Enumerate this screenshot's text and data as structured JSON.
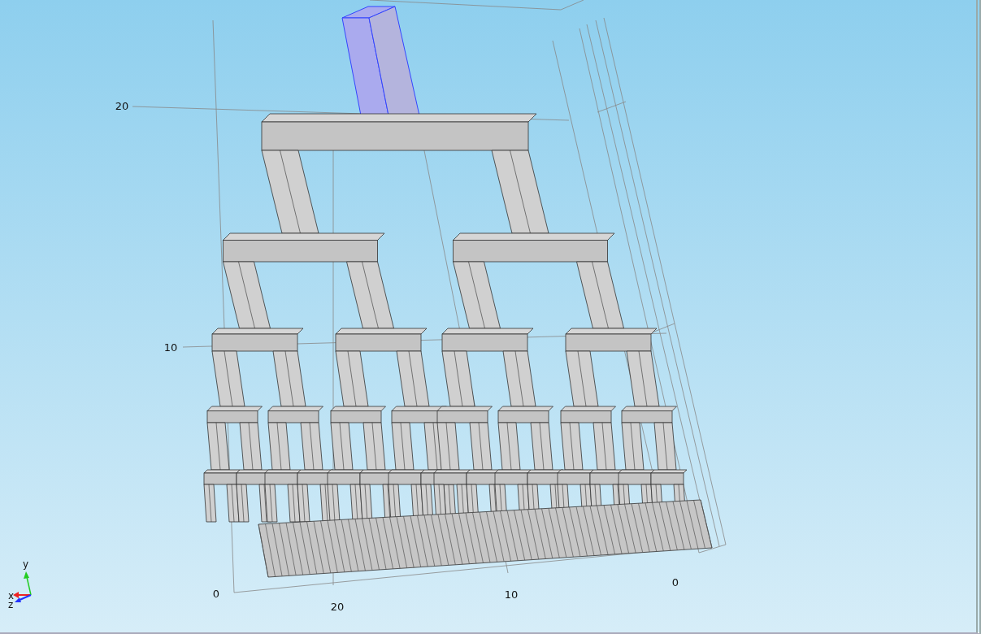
{
  "viewport": {
    "vertical_axis_ticks": [
      "20",
      "10",
      "0"
    ],
    "bottom_axis_ticks": [
      "20",
      "10",
      "0"
    ],
    "inlet_block": {
      "selected": true
    },
    "axis_triad": [
      {
        "kind": "x",
        "label": "x"
      },
      {
        "kind": "y",
        "label": "y"
      },
      {
        "kind": "z",
        "label": "z"
      }
    ]
  }
}
